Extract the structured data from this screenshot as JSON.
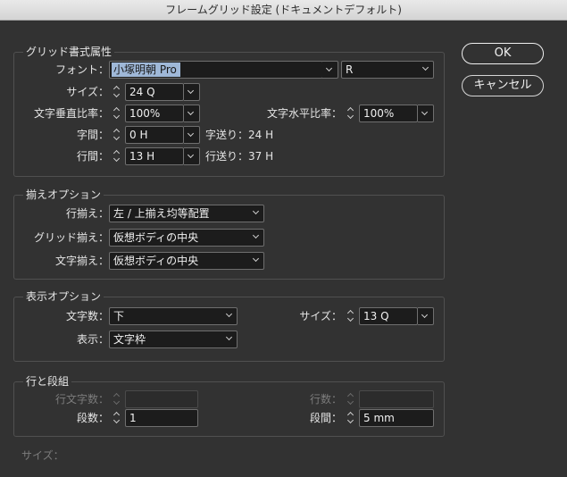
{
  "window": {
    "title": "フレームグリッド設定 (ドキュメントデフォルト)"
  },
  "buttons": {
    "ok": "OK",
    "cancel": "キャンセル"
  },
  "grid_attributes": {
    "title": "グリッド書式属性",
    "font_label": "フォント：",
    "font_value": "小塚明朝 Pro",
    "font_style": "R",
    "size_label": "サイズ：",
    "size_value": "24 Q",
    "vscale_label": "文字垂直比率：",
    "vscale_value": "100%",
    "hscale_label": "文字水平比率：",
    "hscale_value": "100%",
    "char_spacing_label": "字間：",
    "char_spacing_value": "0 H",
    "char_advance": "字送り：24 H",
    "line_spacing_label": "行間：",
    "line_spacing_value": "13 H",
    "line_advance": "行送り：37 H"
  },
  "alignment": {
    "title": "揃えオプション",
    "line_align_label": "行揃え：",
    "line_align_value": "左 / 上揃え均等配置",
    "grid_align_label": "グリッド揃え：",
    "grid_align_value": "仮想ボディの中央",
    "char_align_label": "文字揃え：",
    "char_align_value": "仮想ボディの中央"
  },
  "view": {
    "title": "表示オプション",
    "char_count_label": "文字数：",
    "char_count_value": "下",
    "size_label": "サイズ：",
    "size_value": "13 Q",
    "display_label": "表示：",
    "display_value": "文字枠"
  },
  "rows_columns": {
    "title": "行と段組",
    "chars_per_line_label": "行文字数：",
    "lines_label": "行数：",
    "columns_label": "段数：",
    "columns_value": "1",
    "gutter_label": "段間：",
    "gutter_value": "5 mm"
  },
  "footer": {
    "size_label": "サイズ："
  }
}
